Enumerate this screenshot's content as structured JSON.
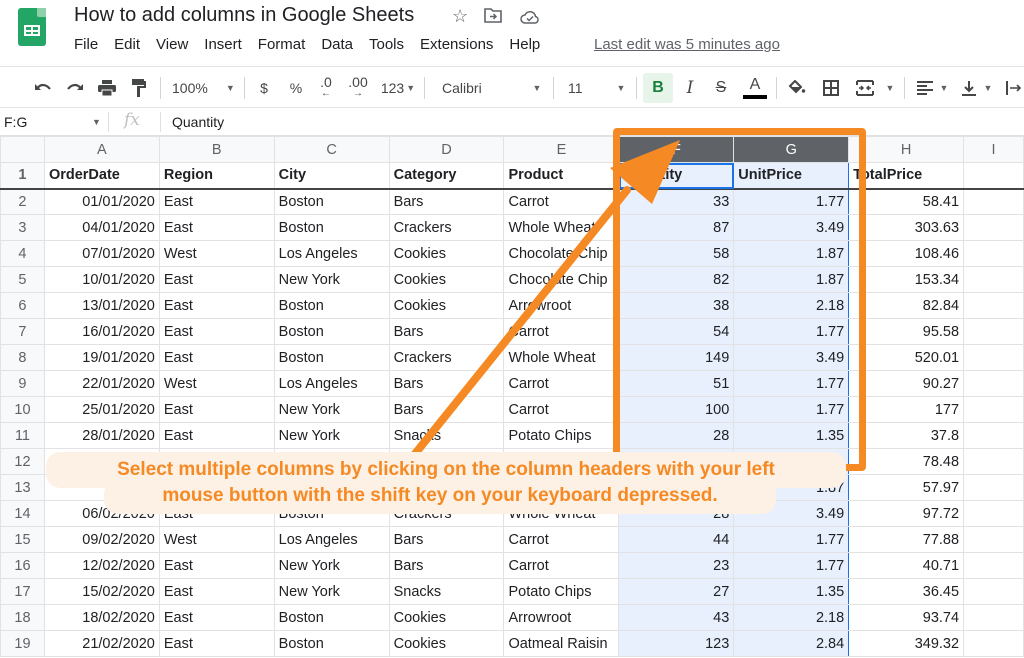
{
  "app": {
    "title": "How to add columns in Google Sheets",
    "title_icons": [
      "star-icon",
      "move-to-folder-icon",
      "cloud-saved-icon"
    ],
    "menu": [
      "File",
      "Edit",
      "View",
      "Insert",
      "Format",
      "Data",
      "Tools",
      "Extensions",
      "Help"
    ],
    "last_edit": "Last edit was 5 minutes ago"
  },
  "toolbar": {
    "zoom": "100%",
    "currency": "$",
    "percent": "%",
    "decrease_decimal": ".0",
    "increase_decimal": ".00",
    "more_formats": "123",
    "font": "Calibri",
    "font_size": "11",
    "bold": "B",
    "italic": "I",
    "strikethrough": "S",
    "text_color": "A",
    "text_color_value": "#000000",
    "accent_active": "#188038"
  },
  "formula_bar": {
    "name_box": "F:G",
    "fx": "fx",
    "value": "Quantity"
  },
  "columns": [
    "A",
    "B",
    "C",
    "D",
    "E",
    "F",
    "G",
    "H",
    "I"
  ],
  "selected_columns": [
    "F",
    "G"
  ],
  "header_row": [
    "OrderDate",
    "Region",
    "City",
    "Category",
    "Product",
    "Quantity",
    "UnitPrice",
    "TotalPrice",
    ""
  ],
  "rows": [
    {
      "n": "2",
      "cells": [
        "01/01/2020",
        "East",
        "Boston",
        "Bars",
        "Carrot",
        "33",
        "1.77",
        "58.41"
      ]
    },
    {
      "n": "3",
      "cells": [
        "04/01/2020",
        "East",
        "Boston",
        "Crackers",
        "Whole Wheat",
        "87",
        "3.49",
        "303.63"
      ]
    },
    {
      "n": "4",
      "cells": [
        "07/01/2020",
        "West",
        "Los Angeles",
        "Cookies",
        "Chocolate Chip",
        "58",
        "1.87",
        "108.46"
      ]
    },
    {
      "n": "5",
      "cells": [
        "10/01/2020",
        "East",
        "New York",
        "Cookies",
        "Chocolate Chip",
        "82",
        "1.87",
        "153.34"
      ]
    },
    {
      "n": "6",
      "cells": [
        "13/01/2020",
        "East",
        "Boston",
        "Cookies",
        "Arrowroot",
        "38",
        "2.18",
        "82.84"
      ]
    },
    {
      "n": "7",
      "cells": [
        "16/01/2020",
        "East",
        "Boston",
        "Bars",
        "Carrot",
        "54",
        "1.77",
        "95.58"
      ]
    },
    {
      "n": "8",
      "cells": [
        "19/01/2020",
        "East",
        "Boston",
        "Crackers",
        "Whole Wheat",
        "149",
        "3.49",
        "520.01"
      ]
    },
    {
      "n": "9",
      "cells": [
        "22/01/2020",
        "West",
        "Los Angeles",
        "Bars",
        "Carrot",
        "51",
        "1.77",
        "90.27"
      ]
    },
    {
      "n": "10",
      "cells": [
        "25/01/2020",
        "East",
        "New York",
        "Bars",
        "Carrot",
        "100",
        "1.77",
        "177"
      ]
    },
    {
      "n": "11",
      "cells": [
        "28/01/2020",
        "East",
        "New York",
        "Snacks",
        "Potato Chips",
        "28",
        "1.35",
        "37.8"
      ]
    },
    {
      "n": "12",
      "cells": [
        "",
        "",
        "",
        "",
        "",
        "",
        "",
        "78.48"
      ]
    },
    {
      "n": "13",
      "cells": [
        "03/0",
        "",
        "",
        "",
        "",
        "",
        "1.87",
        "57.97"
      ]
    },
    {
      "n": "14",
      "cells": [
        "06/02/2020",
        "East",
        "Boston",
        "Crackers",
        "Whole Wheat",
        "28",
        "3.49",
        "97.72"
      ]
    },
    {
      "n": "15",
      "cells": [
        "09/02/2020",
        "West",
        "Los Angeles",
        "Bars",
        "Carrot",
        "44",
        "1.77",
        "77.88"
      ]
    },
    {
      "n": "16",
      "cells": [
        "12/02/2020",
        "East",
        "New York",
        "Bars",
        "Carrot",
        "23",
        "1.77",
        "40.71"
      ]
    },
    {
      "n": "17",
      "cells": [
        "15/02/2020",
        "East",
        "New York",
        "Snacks",
        "Potato Chips",
        "27",
        "1.35",
        "36.45"
      ]
    },
    {
      "n": "18",
      "cells": [
        "18/02/2020",
        "East",
        "Boston",
        "Cookies",
        "Arrowroot",
        "43",
        "2.18",
        "93.74"
      ]
    },
    {
      "n": "19",
      "cells": [
        "21/02/2020",
        "East",
        "Boston",
        "Cookies",
        "Oatmeal Raisin",
        "123",
        "2.84",
        "349.32"
      ]
    }
  ],
  "annotation": {
    "line1": "Select multiple columns by clicking on the column headers with your left",
    "line2": "mouse button with the shift key on your keyboard depressed.",
    "color": "#f58a24"
  }
}
